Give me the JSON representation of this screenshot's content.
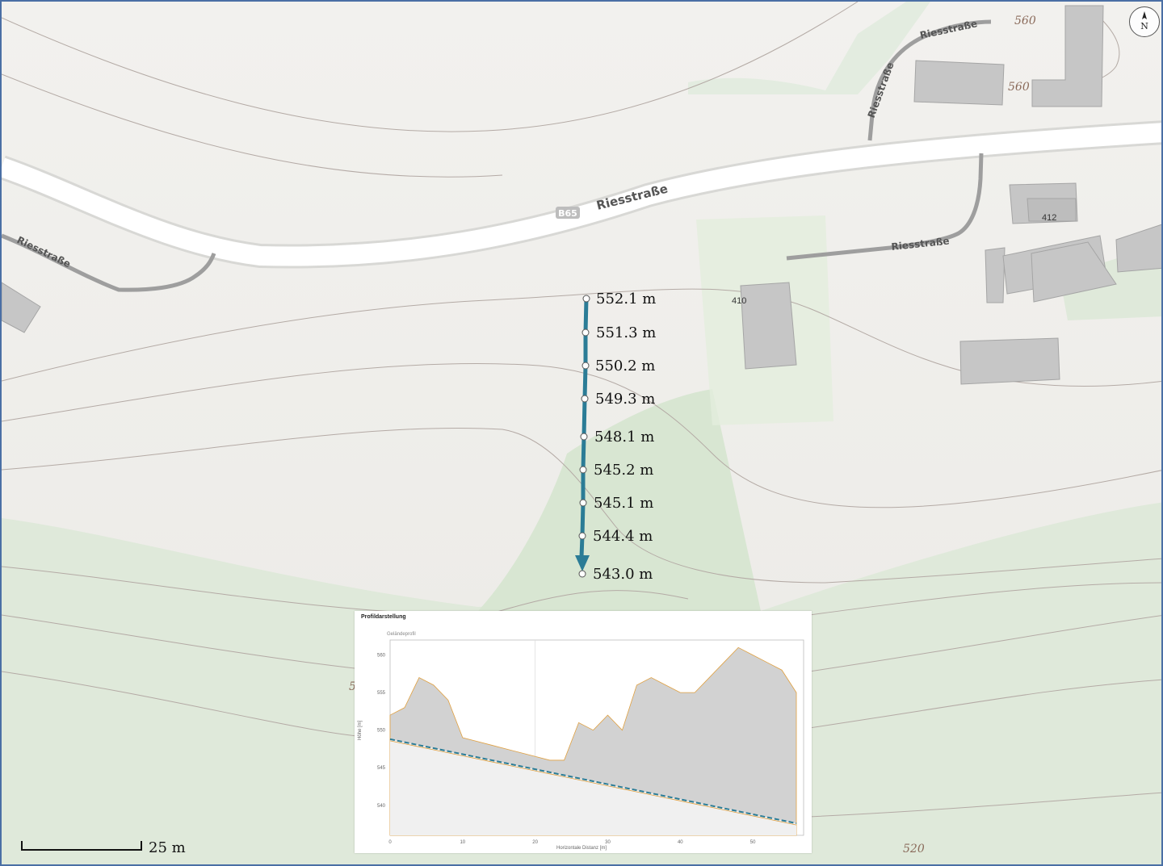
{
  "map": {
    "roads": [
      {
        "name": "Riesstraße",
        "badge": "B65"
      },
      {
        "name": "Riesstraße"
      },
      {
        "name": "Riesstraße"
      },
      {
        "name": "Riesstraße"
      },
      {
        "name": "Riesstraße"
      }
    ],
    "house_numbers": [
      "410",
      "412"
    ],
    "contour_labels": [
      "560",
      "560",
      "520",
      "5"
    ],
    "colors": {
      "route": "#2b7c96",
      "forest": "#dbe8d6",
      "building": "#c8c8c8",
      "road": "#ffffff",
      "minor_road": "#999999",
      "contour": "#b0a39e"
    }
  },
  "route": {
    "points": [
      {
        "elevation": "552.1 m"
      },
      {
        "elevation": "551.3 m"
      },
      {
        "elevation": "550.2 m"
      },
      {
        "elevation": "549.3 m"
      },
      {
        "elevation": "548.1 m"
      },
      {
        "elevation": "545.2 m"
      },
      {
        "elevation": "545.1 m"
      },
      {
        "elevation": "544.4 m"
      },
      {
        "elevation": "543.0 m"
      }
    ]
  },
  "scale": {
    "label": "25 m"
  },
  "north": {
    "label": "N"
  },
  "profile": {
    "title": "Profildarstellung",
    "subtitle": "Geländeprofil",
    "xlabel": "Horizontale Distanz [m]",
    "ylabel": "Höhe [m]",
    "yticks": [
      "560",
      "555",
      "550",
      "545",
      "540"
    ],
    "xticks": [
      "0",
      "10",
      "20",
      "30",
      "40",
      "50"
    ],
    "chart_data": {
      "type": "area",
      "x": [
        0,
        2,
        4,
        6,
        8,
        10,
        12,
        14,
        16,
        18,
        20,
        22,
        24,
        26,
        28,
        30,
        32,
        34,
        36,
        38,
        40,
        42,
        44,
        46,
        48,
        50,
        52,
        54,
        56
      ],
      "series": [
        {
          "values": [
            552,
            553,
            557,
            556,
            554,
            549,
            548.5,
            548,
            547.5,
            547,
            546.5,
            546,
            546,
            551,
            550,
            552,
            550,
            556,
            557,
            556,
            555,
            555,
            557,
            559,
            561,
            560,
            559,
            558,
            555
          ]
        },
        {
          "values": [
            548.8,
            548.4,
            548,
            547.6,
            547.2,
            546.8,
            546.4,
            546,
            545.6,
            545.2,
            544.8,
            544.4,
            544,
            543.6,
            543.2,
            542.8,
            542.4,
            542,
            541.6,
            541.2,
            540.8,
            540.4,
            540,
            539.6,
            539.2,
            538.8,
            538.4,
            538,
            537.6
          ]
        }
      ],
      "ylim": [
        536,
        562
      ],
      "xlim": [
        0,
        57
      ]
    }
  }
}
